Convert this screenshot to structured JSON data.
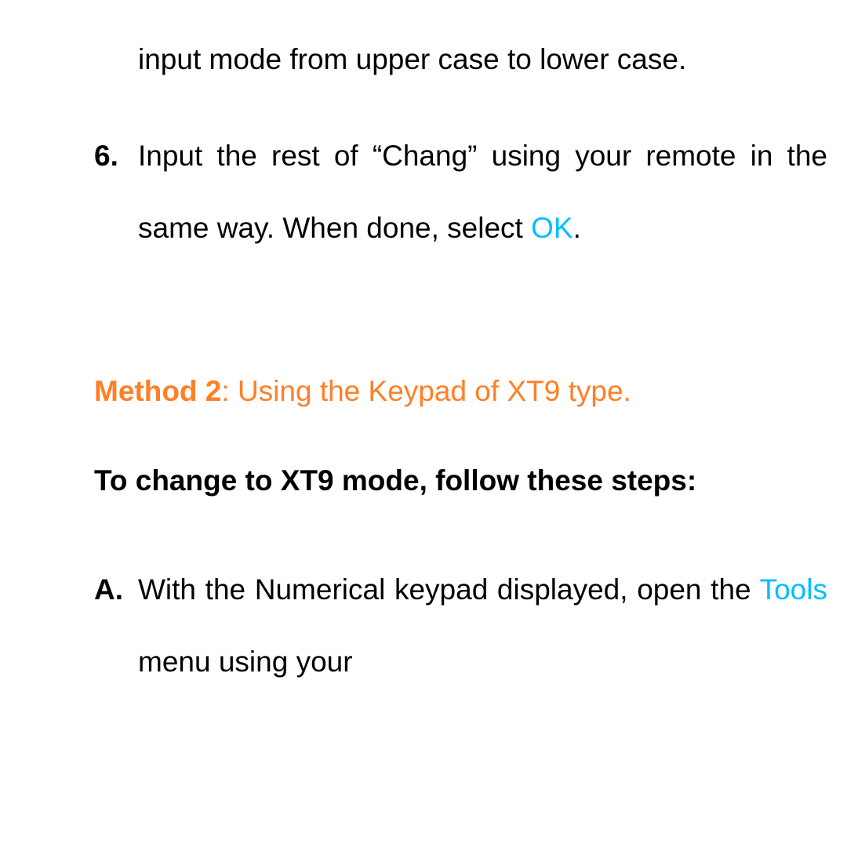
{
  "continuation_text": "input mode from upper case to lower case.",
  "step6": {
    "marker": "6.",
    "text_before": "Input the rest of “Chang” using your remote in the same way. When done, select ",
    "highlight": "OK",
    "text_after": "."
  },
  "method2": {
    "label": "Method 2",
    "text": ": Using the Keypad of XT9 type."
  },
  "sub_heading": "To change to XT9 mode, follow these steps:",
  "stepA": {
    "marker": "A.",
    "text_before": "With the Numerical keypad displayed, open the ",
    "highlight": "Tools",
    "text_after": " menu using your"
  }
}
